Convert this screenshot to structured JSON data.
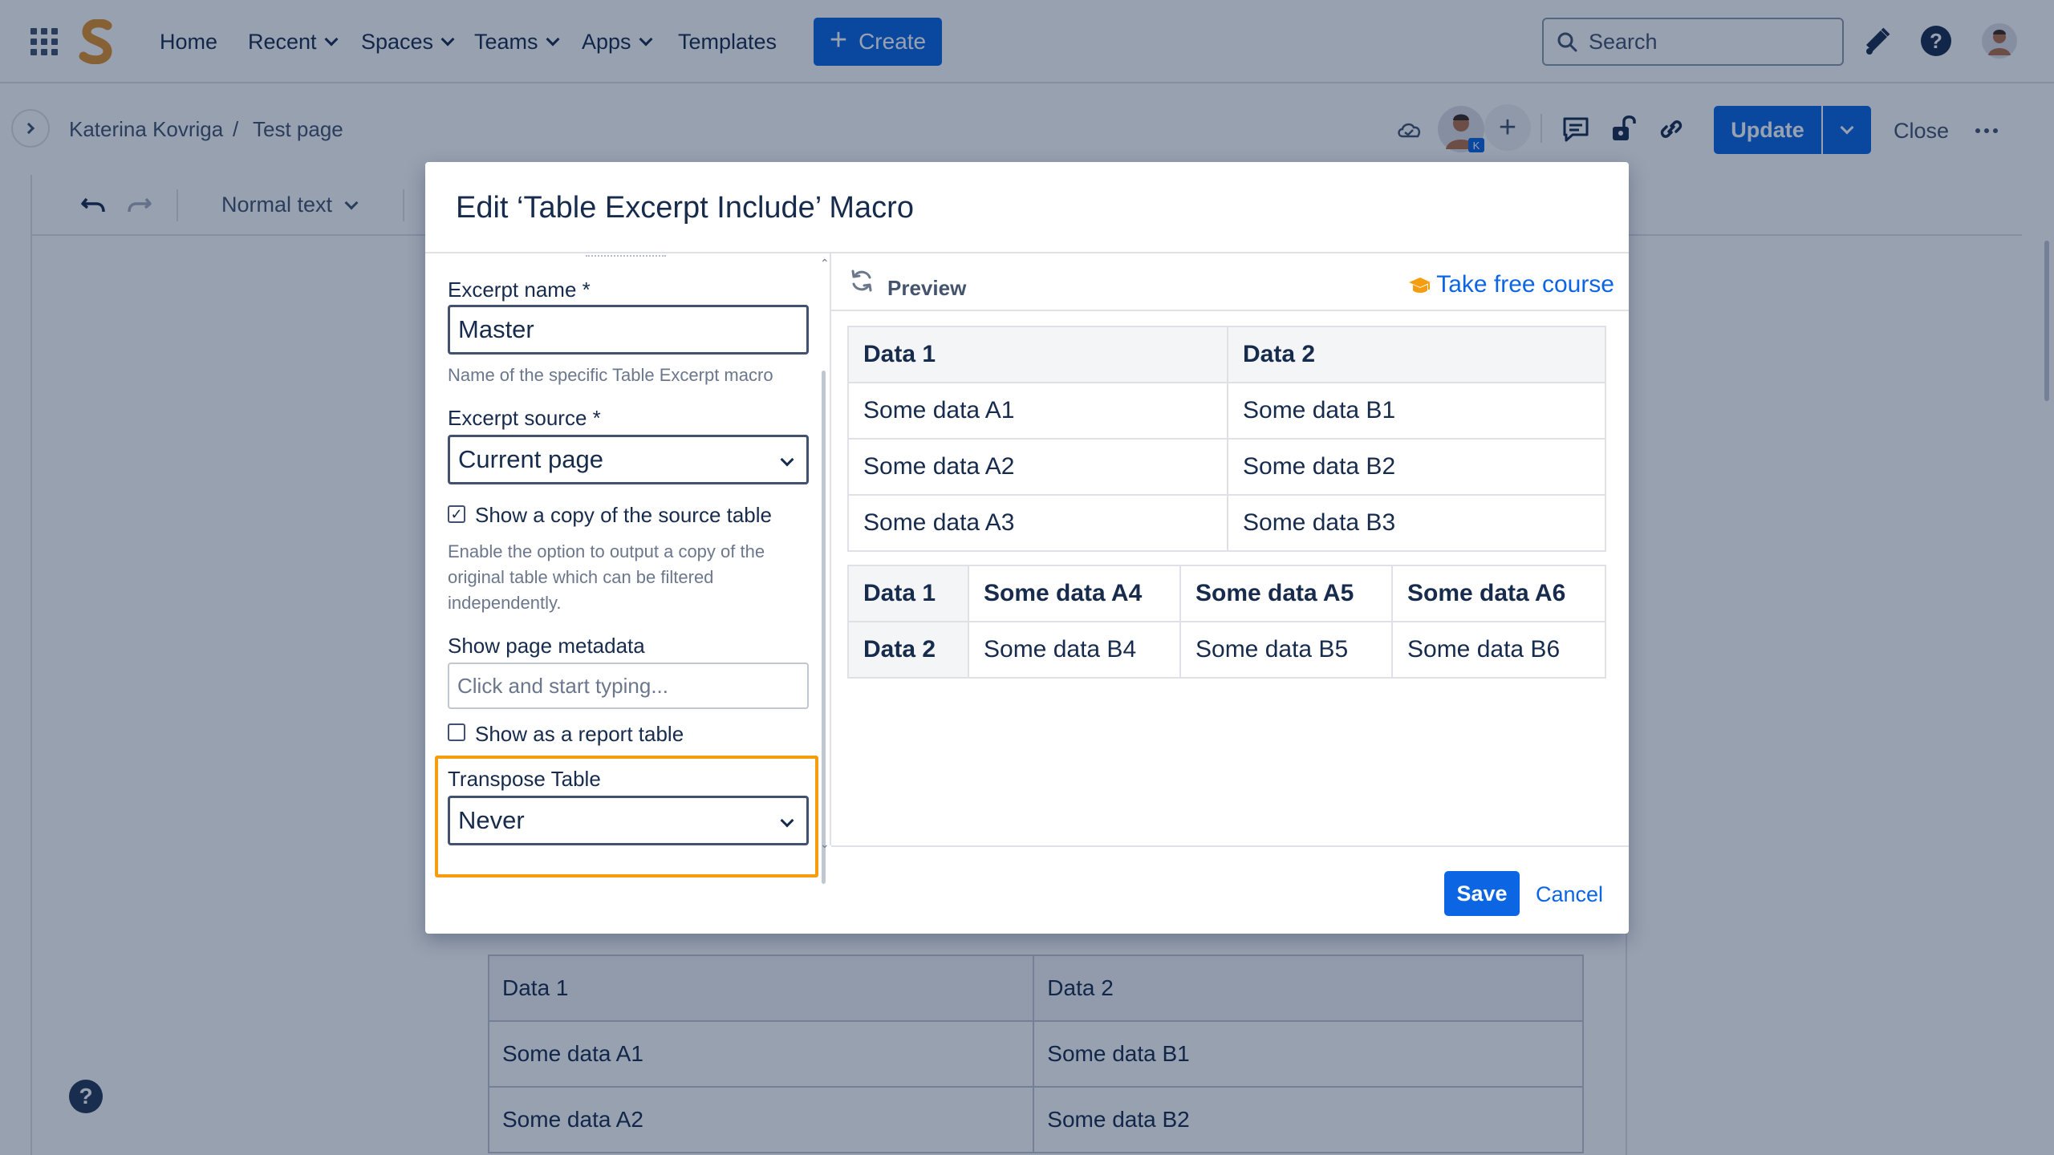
{
  "nav": {
    "items": [
      {
        "label": "Home"
      },
      {
        "label": "Recent"
      },
      {
        "label": "Spaces"
      },
      {
        "label": "Teams"
      },
      {
        "label": "Apps"
      },
      {
        "label": "Templates"
      }
    ],
    "create_label": "Create",
    "search_placeholder": "Search"
  },
  "breadcrumb": {
    "space": "Katerina Kovriga",
    "separator": "/",
    "page": "Test page",
    "avatar_badge": "K"
  },
  "actions": {
    "update_label": "Update",
    "close_label": "Close"
  },
  "toolbar": {
    "text_style": "Normal text"
  },
  "background_table": {
    "rows": [
      [
        "Data 1",
        "Data 2"
      ],
      [
        "Some data A1",
        "Some data B1"
      ],
      [
        "Some data A2",
        "Some data B2"
      ]
    ]
  },
  "modal": {
    "title": "Edit ‘Table Excerpt Include’ Macro",
    "form": {
      "excerpt_name_label": "Excerpt name *",
      "excerpt_name_value": "Master",
      "excerpt_name_help": "Name of the specific Table Excerpt macro",
      "excerpt_source_label": "Excerpt source *",
      "excerpt_source_value": "Current page",
      "show_copy_label": "Show a copy of the source table",
      "show_copy_checked": true,
      "show_copy_help": "Enable the option to output a copy of the original table which can be filtered independently.",
      "metadata_label": "Show page metadata",
      "metadata_placeholder": "Click and start typing...",
      "report_label": "Show as a report table",
      "report_checked": false,
      "transpose_label": "Transpose Table",
      "transpose_value": "Never"
    },
    "preview": {
      "label": "Preview",
      "course_link": "Take free course",
      "table1": {
        "headers": [
          "Data 1",
          "Data 2"
        ],
        "rows": [
          [
            "Some data A1",
            "Some data B1"
          ],
          [
            "Some data A2",
            "Some data B2"
          ],
          [
            "Some data A3",
            "Some data B3"
          ]
        ]
      },
      "table2": {
        "rows": [
          [
            "Data 1",
            "Some data A4",
            "Some data A5",
            "Some data A6"
          ],
          [
            "Data 2",
            "Some data B4",
            "Some data B5",
            "Some data B6"
          ]
        ]
      }
    },
    "save_label": "Save",
    "cancel_label": "Cancel"
  },
  "colors": {
    "primary": "#0c66e4",
    "highlight": "#f59d0e",
    "logo": "#e0912b"
  }
}
